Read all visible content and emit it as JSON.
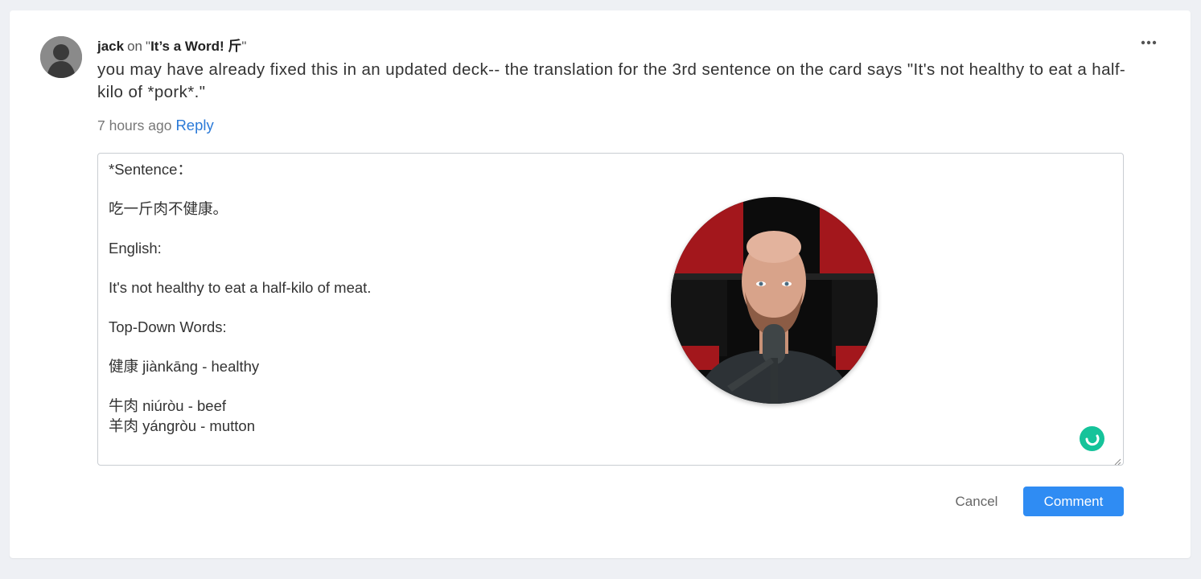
{
  "comment": {
    "author": "jack",
    "on_label": "on",
    "deck_open_quote": "\"",
    "deck_title": "It’s a Word! 斤",
    "deck_close_quote": "\"",
    "text": "you may have already fixed this in an updated deck-- the translation for the 3rd sentence on the card says \"It's not healthy to eat a half-kilo of *pork*.\"",
    "time": "7 hours ago",
    "reply_label": "Reply"
  },
  "reply_editor": {
    "lines": [
      "*Sentence：",
      "",
      "吃一斤肉不健康。",
      "",
      "English:",
      "",
      "It's not healthy to eat a half-kilo of meat.",
      "",
      "Top-Down Words:",
      "",
      "健康 jiànkāng - healthy",
      "",
      "牛肉 niúròu - beef",
      "羊肉 yángròu - mutton"
    ]
  },
  "actions": {
    "cancel_label": "Cancel",
    "comment_label": "Comment"
  },
  "icons": {
    "more": "more-horizontal-icon",
    "grammar": "grammarly-icon",
    "avatar": "default-user-avatar"
  },
  "colors": {
    "accent": "#2f8cf3",
    "link": "#2b7ad8",
    "grammar": "#15c39a"
  }
}
